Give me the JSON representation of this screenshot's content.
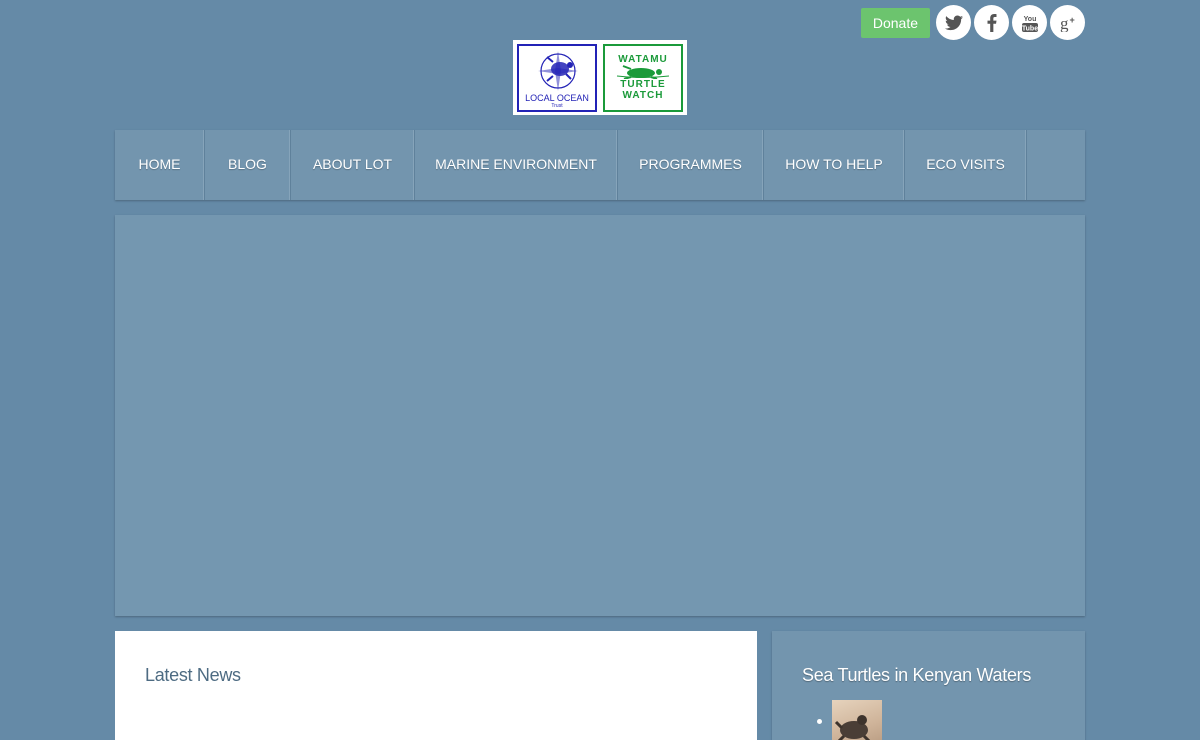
{
  "header": {
    "donate_label": "Donate",
    "social": [
      {
        "icon": "twitter-icon"
      },
      {
        "icon": "facebook-icon"
      },
      {
        "icon": "youtube-icon",
        "label": "You Tube"
      },
      {
        "icon": "google-plus-icon",
        "label": "g+"
      }
    ],
    "logo": {
      "left_text": "LOCAL OCEAN",
      "left_sub": "Trust",
      "right_lines": [
        "WATAMU",
        "TURTLE",
        "WATCH"
      ]
    }
  },
  "nav": {
    "items": [
      {
        "label": "HOME"
      },
      {
        "label": "BLOG"
      },
      {
        "label": "ABOUT LOT"
      },
      {
        "label": "MARINE ENVIRONMENT"
      },
      {
        "label": "PROGRAMMES"
      },
      {
        "label": "HOW TO HELP"
      },
      {
        "label": "ECO VISITS"
      }
    ]
  },
  "news": {
    "title": "Latest News"
  },
  "sidebar": {
    "title": "Sea Turtles in Kenyan Waters"
  },
  "colors": {
    "background": "#658aa7",
    "panel": "#7395ae",
    "donate": "#6cc46e",
    "local_ocean_blue": "#2323b6",
    "turtle_watch_green": "#1b9a3a"
  }
}
